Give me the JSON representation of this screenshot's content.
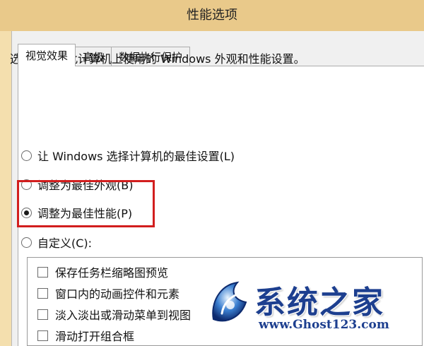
{
  "window": {
    "title": "性能选项"
  },
  "tabs": [
    {
      "label": "视觉效果",
      "active": true
    },
    {
      "label": "高级",
      "active": false
    },
    {
      "label": "数据执行保护",
      "active": false
    }
  ],
  "visual_effects": {
    "description": "选择你想在此计算机上使用的 Windows 外观和性能设置。",
    "options": [
      {
        "label": "让 Windows 选择计算机的最佳设置(L)",
        "checked": false
      },
      {
        "label": "调整为最佳外观(B)",
        "checked": false
      },
      {
        "label": "调整为最佳性能(P)",
        "checked": true
      },
      {
        "label": "自定义(C):",
        "checked": false
      }
    ],
    "effects": [
      {
        "label": "保存任务栏缩略图预览",
        "checked": false
      },
      {
        "label": "窗口内的动画控件和元素",
        "checked": false
      },
      {
        "label": "淡入淡出或滑动菜单到视图",
        "checked": false
      },
      {
        "label": "滑动打开组合框",
        "checked": false
      }
    ]
  },
  "watermark": {
    "brand": "系统之家",
    "url": "www.Ghost123.com"
  },
  "colors": {
    "highlight": "#d21e1e",
    "watermark_blue": "#1d3f8f",
    "title_bar": "#e9c98a"
  }
}
